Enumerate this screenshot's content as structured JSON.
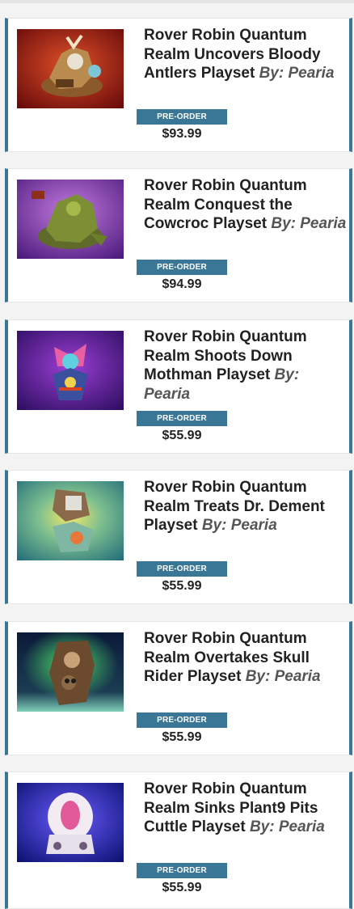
{
  "products": [
    {
      "name": "Rover Robin Quantum Realm Uncovers Bloody Antlers Playset",
      "by": "By: Pearia",
      "button": "PRE-ORDER",
      "price": "$93.99",
      "image_icon": "toy-playset-image"
    },
    {
      "name": "Rover Robin Quantum Realm Conquest the Cowcroc Playset",
      "by": "By: Pearia",
      "button": "PRE-ORDER",
      "price": "$94.99",
      "image_icon": "toy-playset-image"
    },
    {
      "name": "Rover Robin Quantum Realm Shoots Down Mothman Playset",
      "by": "By: Pearia",
      "button": "PRE-ORDER",
      "price": "$55.99",
      "image_icon": "toy-playset-image"
    },
    {
      "name": "Rover Robin Quantum Realm Treats Dr. Dement Playset",
      "by": "By: Pearia",
      "button": "PRE-ORDER",
      "price": "$55.99",
      "image_icon": "toy-playset-image"
    },
    {
      "name": "Rover Robin Quantum Realm Overtakes Skull Rider Playset",
      "by": "By: Pearia",
      "button": "PRE-ORDER",
      "price": "$55.99",
      "image_icon": "toy-playset-image"
    },
    {
      "name": "Rover Robin Quantum Realm Sinks Plant9 Pits Cuttle Playset",
      "by": "By: Pearia",
      "button": "PRE-ORDER",
      "price": "$55.99",
      "image_icon": "toy-playset-image"
    }
  ],
  "colors": {
    "accent": "#3a7796",
    "background": "#f3f3f3"
  }
}
